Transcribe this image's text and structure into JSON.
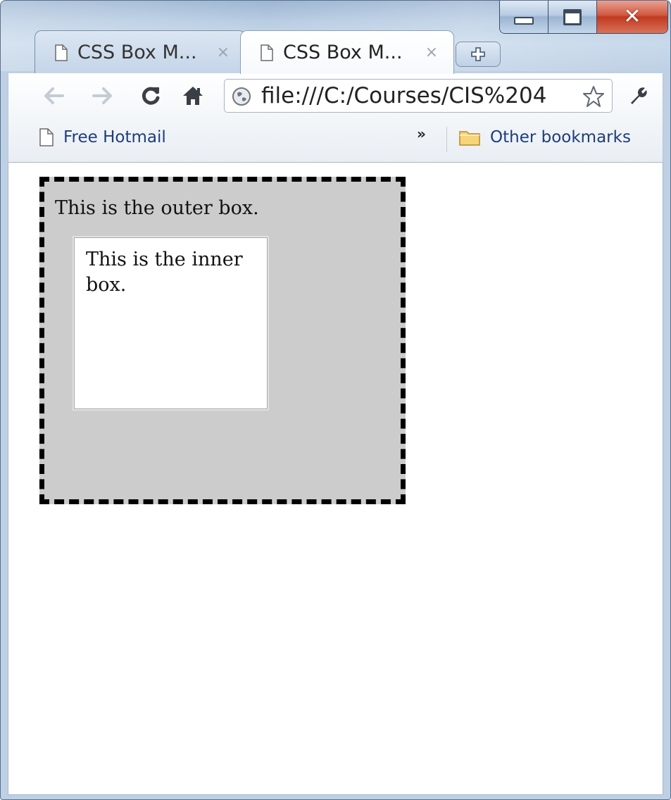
{
  "window": {
    "controls": {
      "minimize": "minimize",
      "maximize": "maximize",
      "close": "close"
    }
  },
  "tabs": [
    {
      "title": "CSS Box M...",
      "active": false,
      "close_glyph": "×"
    },
    {
      "title": "CSS Box M...",
      "active": true,
      "close_glyph": "×"
    }
  ],
  "toolbar": {
    "url": "file:///C:/Courses/CIS%204",
    "icons": [
      "back-arrow-icon",
      "forward-arrow-icon",
      "reload-icon",
      "home-icon",
      "globe-icon",
      "star-icon",
      "wrench-icon"
    ]
  },
  "bookmarks": {
    "items": [
      {
        "label": "Free Hotmail"
      }
    ],
    "overflow_glyph": "»",
    "other_label": "Other bookmarks"
  },
  "page": {
    "outer_box_text": "This is the outer box.",
    "inner_box_text": "This is the inner box.",
    "outer_box_bg": "#cccccc",
    "inner_box_bg": "#ffffff",
    "outer_border_color": "#000000"
  }
}
